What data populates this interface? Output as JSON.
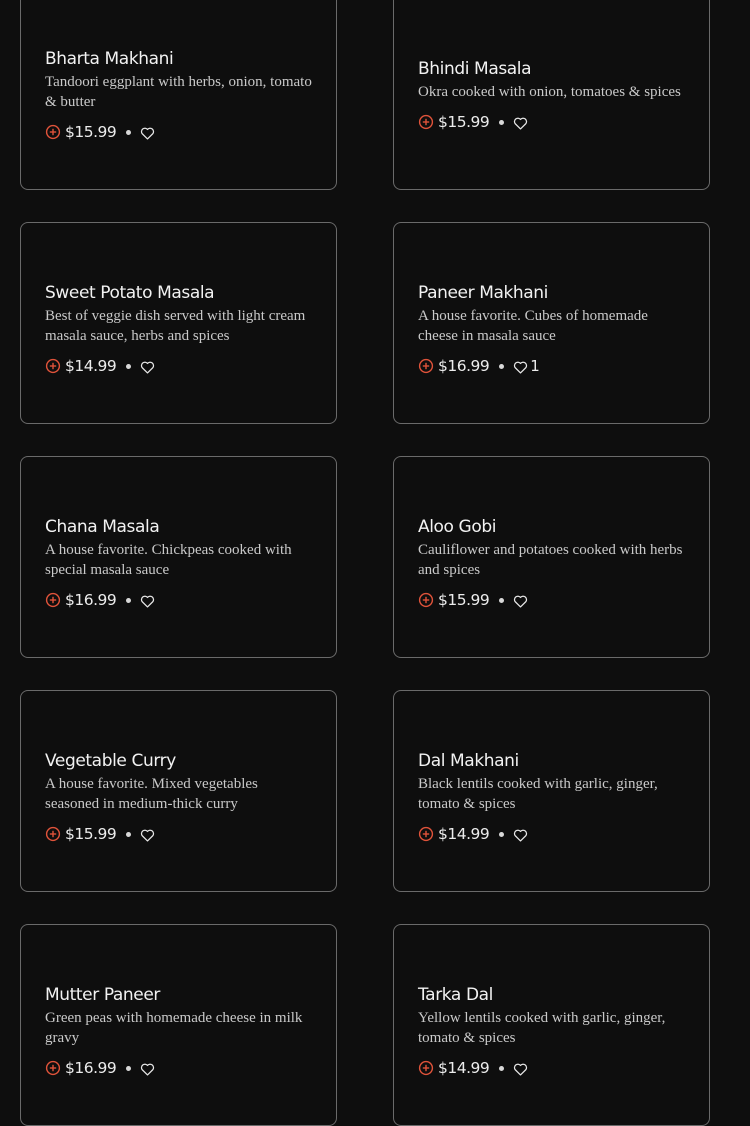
{
  "colors": {
    "background": "#0e0e0e",
    "card_border": "#6a6a6a",
    "accent": "#e0533a",
    "title": "#f2f2f2",
    "description": "#c9c9c9"
  },
  "icons": {
    "add": "plus-circle-icon",
    "like": "heart-outline-icon"
  },
  "menu": {
    "items": [
      {
        "name": "Bharta Makhani",
        "description": "Tandoori eggplant with herbs, onion, tomato & butter",
        "price": "$15.99",
        "likes": ""
      },
      {
        "name": "Bhindi Masala",
        "description": "Okra cooked with onion, tomatoes & spices",
        "price": "$15.99",
        "likes": ""
      },
      {
        "name": "Sweet Potato Masala",
        "description": "Best of veggie dish served with light cream masala sauce, herbs and spices",
        "price": "$14.99",
        "likes": ""
      },
      {
        "name": "Paneer Makhani",
        "description": "A house favorite. Cubes of homemade cheese in masala sauce",
        "price": "$16.99",
        "likes": "1"
      },
      {
        "name": "Chana Masala",
        "description": "A house favorite. Chickpeas cooked with special masala sauce",
        "price": "$16.99",
        "likes": ""
      },
      {
        "name": "Aloo Gobi",
        "description": "Cauliflower and potatoes cooked with herbs and spices",
        "price": "$15.99",
        "likes": ""
      },
      {
        "name": "Vegetable Curry",
        "description": "A house favorite. Mixed vegetables seasoned in medium-thick curry",
        "price": "$15.99",
        "likes": ""
      },
      {
        "name": "Dal Makhani",
        "description": "Black lentils cooked with garlic, ginger, tomato & spices",
        "price": "$14.99",
        "likes": ""
      },
      {
        "name": "Mutter Paneer",
        "description": "Green peas with homemade cheese in milk gravy",
        "price": "$16.99",
        "likes": ""
      },
      {
        "name": "Tarka Dal",
        "description": "Yellow lentils cooked with garlic, ginger, tomato & spices",
        "price": "$14.99",
        "likes": ""
      }
    ]
  }
}
